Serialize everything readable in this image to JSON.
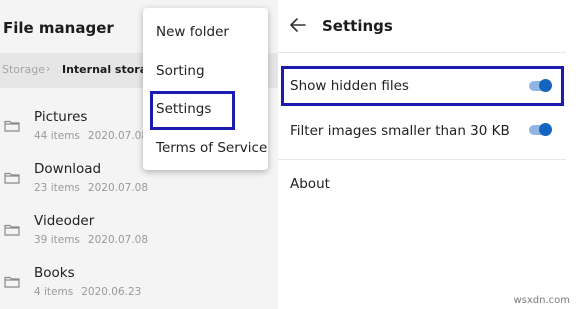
{
  "file_manager": {
    "title": "File manager",
    "breadcrumb": {
      "root": "Storage",
      "separator": "›",
      "current": "Internal storage"
    },
    "folders": [
      {
        "name": "Pictures",
        "count": "44 items",
        "date": "2020.07.08"
      },
      {
        "name": "Download",
        "count": "23 items",
        "date": "2020.07.08"
      },
      {
        "name": "Videoder",
        "count": "39 items",
        "date": "2020.07.08"
      },
      {
        "name": "Books",
        "count": "4 items",
        "date": "2020.06.23"
      }
    ]
  },
  "menu": {
    "items": [
      "New folder",
      "Sorting",
      "Settings",
      "Terms of Service"
    ]
  },
  "settings": {
    "back_icon": "arrow-left-icon",
    "title": "Settings",
    "options": [
      {
        "label": "Show hidden files",
        "enabled": true
      },
      {
        "label": "Filter images smaller than 30 KB",
        "enabled": true
      },
      {
        "label": "About"
      }
    ]
  },
  "colors": {
    "highlight_border": "#1b1bb0",
    "toggle_on": "#1565c0",
    "toggle_track": "#8fb5e4"
  },
  "watermark": "wsxdn.com"
}
